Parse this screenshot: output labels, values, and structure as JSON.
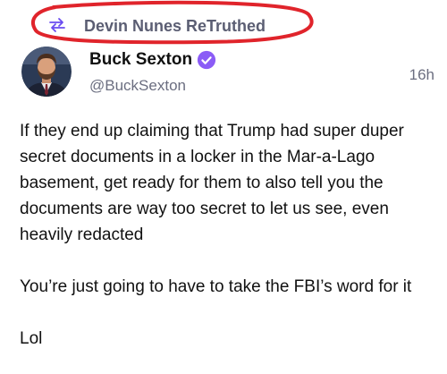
{
  "retruth": {
    "icon": "retruth-icon",
    "label": "Devin Nunes ReTruthed"
  },
  "post": {
    "author_name": "Buck Sexton",
    "author_handle": "@BuckSexton",
    "verified_icon": "verified-badge-icon",
    "timestamp": "16h",
    "paragraphs": [
      "If they end up claiming that Trump had super duper secret documents in a locker in the Mar-a-Lago basement, get ready for them to also tell you the documents are way too secret to let us see, even heavily redacted",
      "You’re just going to have to take the FBI’s word for it",
      "Lol"
    ]
  },
  "colors": {
    "retruth_text": "#5b5e73",
    "retruth_icon": "#6a4cf0",
    "verified_badge": "#8b5cf6",
    "highlight_circle": "#e0242b",
    "handle_text": "#6b6e80"
  }
}
